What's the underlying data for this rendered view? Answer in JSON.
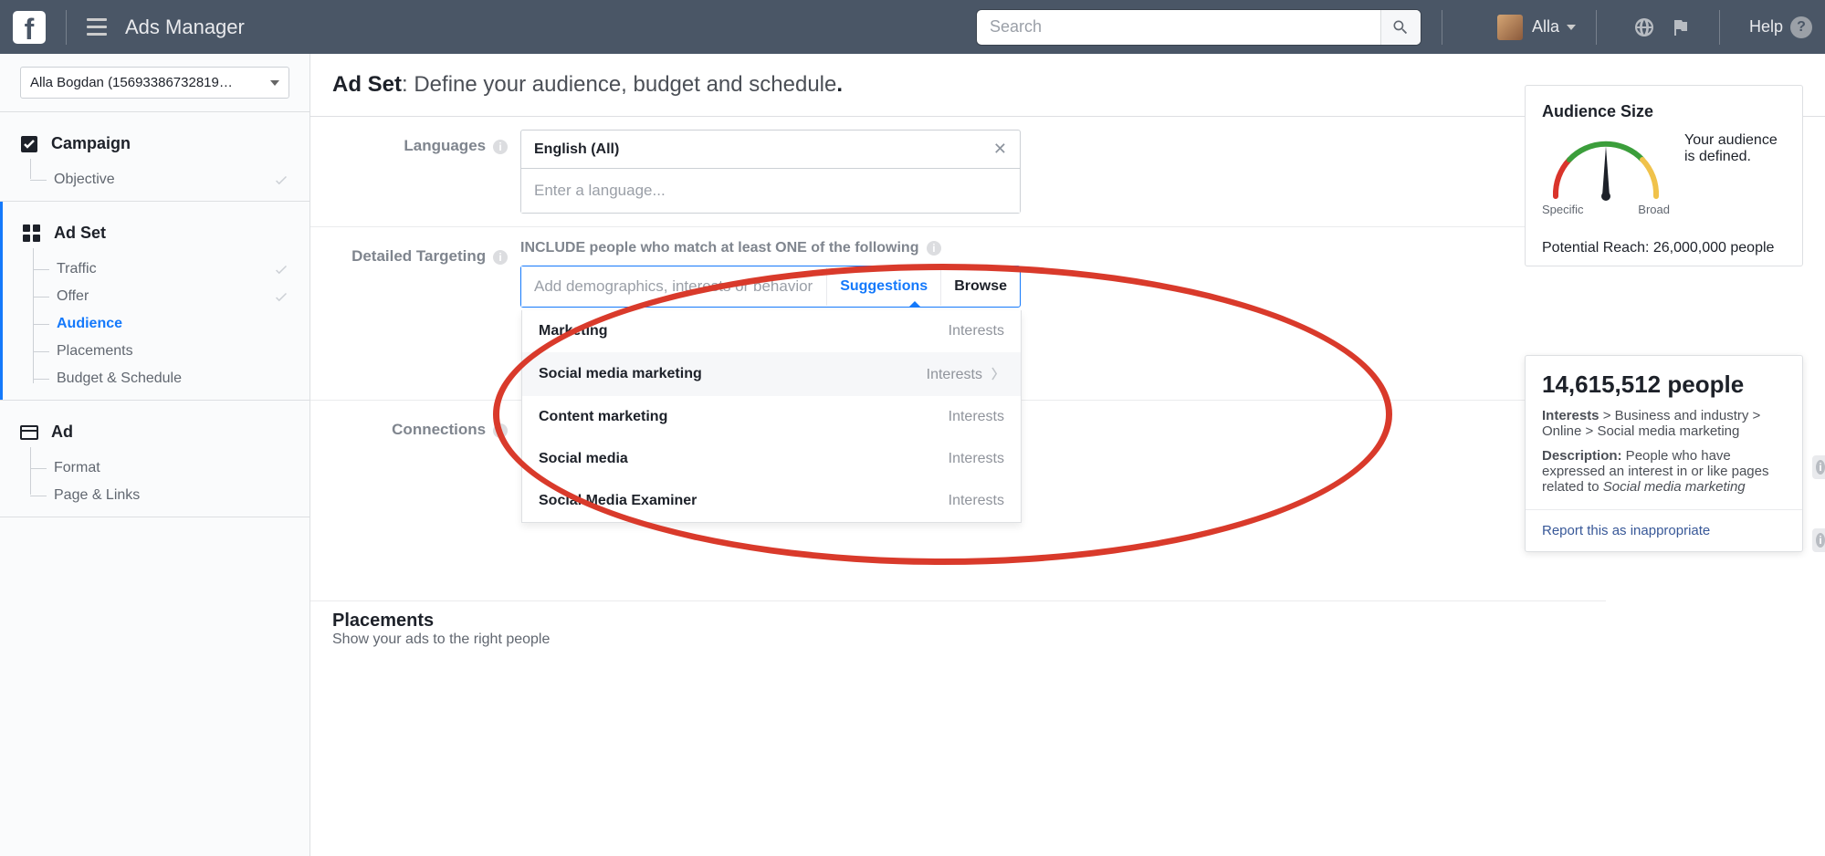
{
  "topbar": {
    "app_title": "Ads Manager",
    "search_placeholder": "Search",
    "user_name": "Alla",
    "help_label": "Help"
  },
  "sidebar": {
    "account_label": "Alla Bogdan (15693386732819…",
    "campaign": {
      "title": "Campaign",
      "items": [
        {
          "label": "Objective",
          "checked": true
        }
      ]
    },
    "adset": {
      "title": "Ad Set",
      "items": [
        {
          "label": "Traffic",
          "checked": true,
          "active": false
        },
        {
          "label": "Offer",
          "checked": true,
          "active": false
        },
        {
          "label": "Audience",
          "checked": false,
          "active": true
        },
        {
          "label": "Placements",
          "checked": false,
          "active": false
        },
        {
          "label": "Budget & Schedule",
          "checked": false,
          "active": false
        }
      ]
    },
    "ad": {
      "title": "Ad",
      "items": [
        {
          "label": "Format"
        },
        {
          "label": "Page & Links"
        }
      ]
    }
  },
  "content": {
    "header_bold": "Ad Set",
    "header_rest": ": Define your audience, budget and schedule",
    "header_dot": ".",
    "languages_label": "Languages",
    "lang_chip": "English (All)",
    "lang_placeholder": "Enter a language...",
    "detailed_label": "Detailed Targeting",
    "include_text": "INCLUDE people who match at least ONE of the following",
    "targeting_placeholder": "Add demographics, interests or behaviors",
    "tab_suggestions": "Suggestions",
    "tab_browse": "Browse",
    "suggestions": [
      {
        "label": "Marketing",
        "cat": "Interests",
        "hover": false
      },
      {
        "label": "Social media marketing",
        "cat": "Interests",
        "hover": true
      },
      {
        "label": "Content marketing",
        "cat": "Interests",
        "hover": false
      },
      {
        "label": "Social media",
        "cat": "Interests",
        "hover": false
      },
      {
        "label": "Social Media Examiner",
        "cat": "Interests",
        "hover": false
      }
    ],
    "connections_label": "Connections",
    "placements_title": "Placements",
    "placements_sub": "Show your ads to the right people"
  },
  "audience": {
    "title": "Audience Size",
    "gauge_specific": "Specific",
    "gauge_broad": "Broad",
    "defined_text": "Your audience is defined.",
    "reach_label": "Potential Reach: ",
    "reach_value": "26,000,000 people"
  },
  "details": {
    "count": "14,615,512",
    "people": " people",
    "interests_label": "Interests",
    "path": " > Business and industry > Online > Social media marketing",
    "desc_label": "Description:",
    "desc_text": " People who have expressed an interest in or like pages related to ",
    "desc_italic": "Social media marketing",
    "report": "Report this as inappropriate"
  }
}
